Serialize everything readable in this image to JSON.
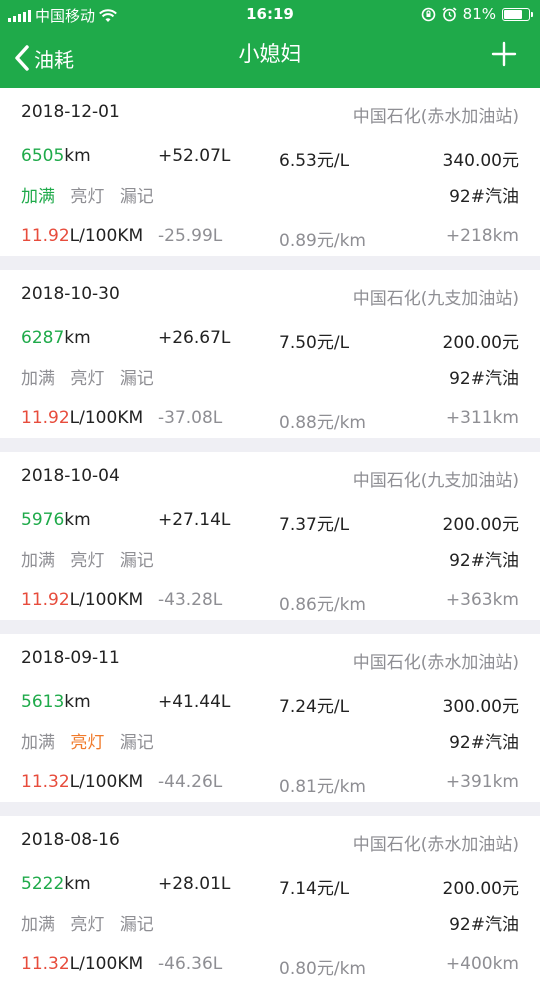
{
  "status": {
    "carrier": "中国移动",
    "time": "16:19",
    "battery": "81%",
    "battery_level": 0.81
  },
  "nav": {
    "back_label": "油耗",
    "title": "小媳妇"
  },
  "records": [
    {
      "date": "2018-12-01",
      "station": "中国石化(赤水加油站)",
      "odometer": "6505",
      "odometer_unit": "km",
      "liters": "+52.07L",
      "price": "6.53元/L",
      "amount": "340.00元",
      "tag_full": "加满",
      "tag_light": "亮灯",
      "tag_missed": "漏记",
      "full_active": true,
      "light_active": false,
      "fuel_type": "92#汽油",
      "consumption": "11.92",
      "consumption_unit": "L/100KM",
      "diff": "-25.99L",
      "cost_per_km": "0.89元/km",
      "distance": "+218km"
    },
    {
      "date": "2018-10-30",
      "station": "中国石化(九支加油站)",
      "odometer": "6287",
      "odometer_unit": "km",
      "liters": "+26.67L",
      "price": "7.50元/L",
      "amount": "200.00元",
      "tag_full": "加满",
      "tag_light": "亮灯",
      "tag_missed": "漏记",
      "full_active": false,
      "light_active": false,
      "fuel_type": "92#汽油",
      "consumption": "11.92",
      "consumption_unit": "L/100KM",
      "diff": "-37.08L",
      "cost_per_km": "0.88元/km",
      "distance": "+311km"
    },
    {
      "date": "2018-10-04",
      "station": "中国石化(九支加油站)",
      "odometer": "5976",
      "odometer_unit": "km",
      "liters": "+27.14L",
      "price": "7.37元/L",
      "amount": "200.00元",
      "tag_full": "加满",
      "tag_light": "亮灯",
      "tag_missed": "漏记",
      "full_active": false,
      "light_active": false,
      "fuel_type": "92#汽油",
      "consumption": "11.92",
      "consumption_unit": "L/100KM",
      "diff": "-43.28L",
      "cost_per_km": "0.86元/km",
      "distance": "+363km"
    },
    {
      "date": "2018-09-11",
      "station": "中国石化(赤水加油站)",
      "odometer": "5613",
      "odometer_unit": "km",
      "liters": "+41.44L",
      "price": "7.24元/L",
      "amount": "300.00元",
      "tag_full": "加满",
      "tag_light": "亮灯",
      "tag_missed": "漏记",
      "full_active": false,
      "light_active": true,
      "fuel_type": "92#汽油",
      "consumption": "11.32",
      "consumption_unit": "L/100KM",
      "diff": "-44.26L",
      "cost_per_km": "0.81元/km",
      "distance": "+391km"
    },
    {
      "date": "2018-08-16",
      "station": "中国石化(赤水加油站)",
      "odometer": "5222",
      "odometer_unit": "km",
      "liters": "+28.01L",
      "price": "7.14元/L",
      "amount": "200.00元",
      "tag_full": "加满",
      "tag_light": "亮灯",
      "tag_missed": "漏记",
      "full_active": false,
      "light_active": false,
      "fuel_type": "92#汽油",
      "consumption": "11.32",
      "consumption_unit": "L/100KM",
      "diff": "-46.36L",
      "cost_per_km": "0.80元/km",
      "distance": "+400km"
    }
  ],
  "colors": {
    "brand": "#1faa4a",
    "consumption": "#e74c3c",
    "light_on": "#f07a2a",
    "secondary": "#8e8e93"
  }
}
